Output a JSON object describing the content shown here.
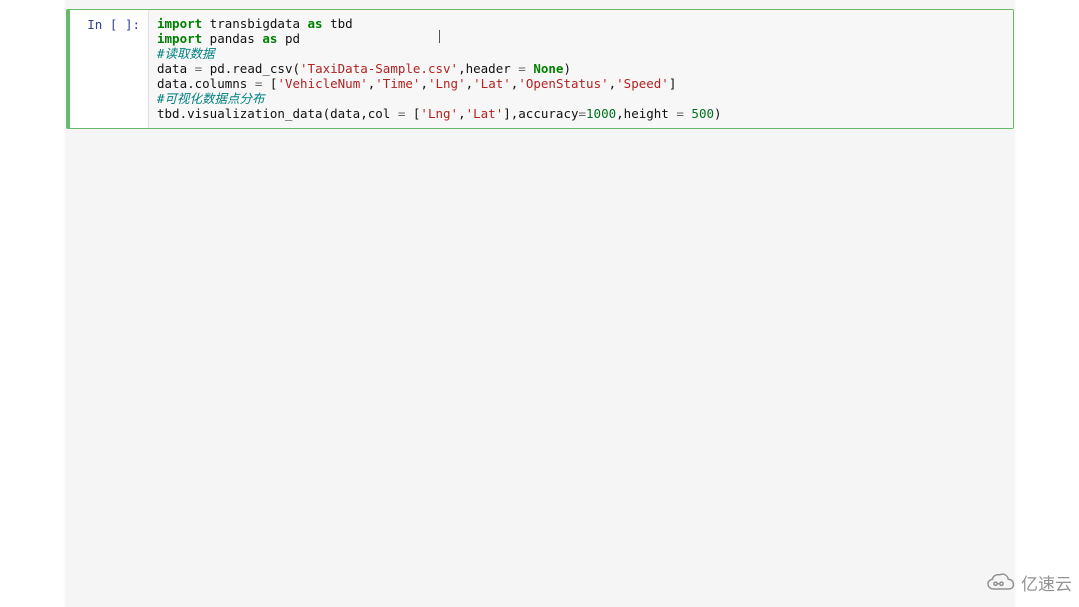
{
  "cell": {
    "prompt_prefix": "In",
    "prompt_number": " ",
    "code_lines": [
      [
        {
          "cls": "kw",
          "t": "import"
        },
        {
          "cls": "name",
          "t": " transbigdata "
        },
        {
          "cls": "kw",
          "t": "as"
        },
        {
          "cls": "name",
          "t": " tbd"
        }
      ],
      [
        {
          "cls": "kw",
          "t": "import"
        },
        {
          "cls": "name",
          "t": " pandas "
        },
        {
          "cls": "kw",
          "t": "as"
        },
        {
          "cls": "name",
          "t": " pd"
        }
      ],
      [
        {
          "cls": "cmt-it",
          "t": "#读取数据"
        }
      ],
      [
        {
          "cls": "name",
          "t": "data "
        },
        {
          "cls": "op",
          "t": "="
        },
        {
          "cls": "name",
          "t": " pd.read_csv("
        },
        {
          "cls": "str",
          "t": "'TaxiData-Sample.csv'"
        },
        {
          "cls": "name",
          "t": ",header "
        },
        {
          "cls": "op",
          "t": "="
        },
        {
          "cls": "name",
          "t": " "
        },
        {
          "cls": "none",
          "t": "None"
        },
        {
          "cls": "name",
          "t": ")"
        }
      ],
      [
        {
          "cls": "name",
          "t": "data.columns "
        },
        {
          "cls": "op",
          "t": "="
        },
        {
          "cls": "name",
          "t": " ["
        },
        {
          "cls": "str",
          "t": "'VehicleNum'"
        },
        {
          "cls": "name",
          "t": ","
        },
        {
          "cls": "str",
          "t": "'Time'"
        },
        {
          "cls": "name",
          "t": ","
        },
        {
          "cls": "str",
          "t": "'Lng'"
        },
        {
          "cls": "name",
          "t": ","
        },
        {
          "cls": "str",
          "t": "'Lat'"
        },
        {
          "cls": "name",
          "t": ","
        },
        {
          "cls": "str",
          "t": "'OpenStatus'"
        },
        {
          "cls": "name",
          "t": ","
        },
        {
          "cls": "str",
          "t": "'Speed'"
        },
        {
          "cls": "name",
          "t": "]"
        }
      ],
      [
        {
          "cls": "cmt-it",
          "t": "#可视化数据点分布"
        }
      ],
      [
        {
          "cls": "name",
          "t": "tbd.visualization_data(data,col "
        },
        {
          "cls": "op",
          "t": "="
        },
        {
          "cls": "name",
          "t": " ["
        },
        {
          "cls": "str",
          "t": "'Lng'"
        },
        {
          "cls": "name",
          "t": ","
        },
        {
          "cls": "str",
          "t": "'Lat'"
        },
        {
          "cls": "name",
          "t": "],accuracy"
        },
        {
          "cls": "op",
          "t": "="
        },
        {
          "cls": "num",
          "t": "1000"
        },
        {
          "cls": "name",
          "t": ",height "
        },
        {
          "cls": "op",
          "t": "="
        },
        {
          "cls": "name",
          "t": " "
        },
        {
          "cls": "num",
          "t": "500"
        },
        {
          "cls": "name",
          "t": ")"
        }
      ]
    ]
  },
  "watermark": {
    "text": "亿速云"
  }
}
